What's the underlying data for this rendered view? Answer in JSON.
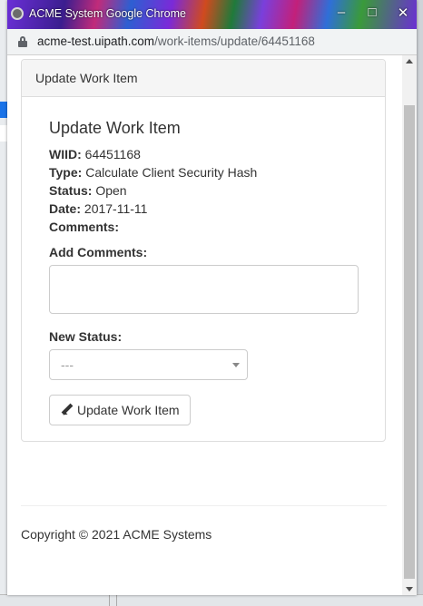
{
  "window": {
    "title": "ACME System  Google Chrome",
    "controls": {
      "minimize": "–",
      "maximize": "□",
      "close": "✕"
    }
  },
  "address": {
    "host": "acme-test.uipath.com",
    "path": "/work-items/update/64451168"
  },
  "panel": {
    "heading": "Update Work Item",
    "form_title": "Update Work Item",
    "fields": {
      "wiid_label": "WIID:",
      "wiid_value": "64451168",
      "type_label": "Type:",
      "type_value": "Calculate Client Security Hash",
      "status_label": "Status:",
      "status_value": "Open",
      "date_label": "Date:",
      "date_value": "2017-11-11",
      "comments_label": "Comments:"
    },
    "add_comments_label": "Add Comments:",
    "comments_value": "",
    "new_status_label": "New Status:",
    "new_status_selected": "---",
    "update_button": "Update Work Item"
  },
  "footer": {
    "copyright": "Copyright © 2021 ACME Systems"
  }
}
